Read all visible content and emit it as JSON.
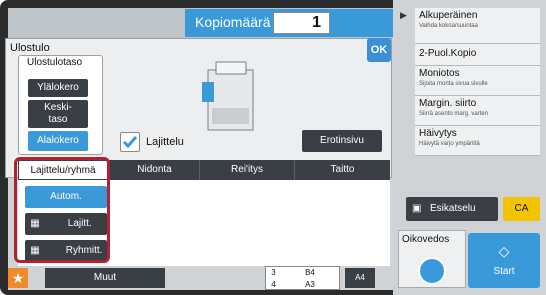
{
  "header": {
    "copies_label": "Kopiomäärä",
    "copies_value": "1"
  },
  "output": {
    "title": "Ulostulo",
    "ok_label": "OK",
    "tray_title": "Ulostulotaso",
    "trays": [
      {
        "label": "Ylälokero"
      },
      {
        "label": "Keski-\ntaso"
      },
      {
        "label": "Alalokero"
      }
    ],
    "lajittelu_label": "Lajittelu",
    "separator_label": "Erotinsivu"
  },
  "tabs": [
    "Lajittelu/ryhmä",
    "Nidonta",
    "Rei'itys",
    "Taitto"
  ],
  "options": [
    "Autom.",
    "Lajitt.",
    "Ryhmitt."
  ],
  "bottom": {
    "muut_label": "Muut",
    "tray_table": [
      [
        "3",
        "B4"
      ],
      [
        "4",
        "A3"
      ]
    ],
    "paper_size": "A4"
  },
  "right_panel": {
    "items": [
      {
        "title": "Alkuperäinen",
        "subtitle": "Vaihda kokoa/suuntaa"
      },
      {
        "title": "2-Puol.Kopio",
        "subtitle": ""
      },
      {
        "title": "Moniotos",
        "subtitle": "Sijoita monta sivua sivulle"
      },
      {
        "title": "Margin. siirto",
        "subtitle": "Siirrä asento marg. varten"
      },
      {
        "title": "Häivytys",
        "subtitle": "Häivytä varjo ympäriltä"
      }
    ],
    "preview_label": "Esikatselu",
    "ca_label": "CA",
    "proof_label": "Oikovedos",
    "start_label": "Start"
  },
  "colors": {
    "accent": "#3a9ad9",
    "dark": "#3a3f45",
    "highlight": "#b22231",
    "ca": "#f2c400"
  }
}
